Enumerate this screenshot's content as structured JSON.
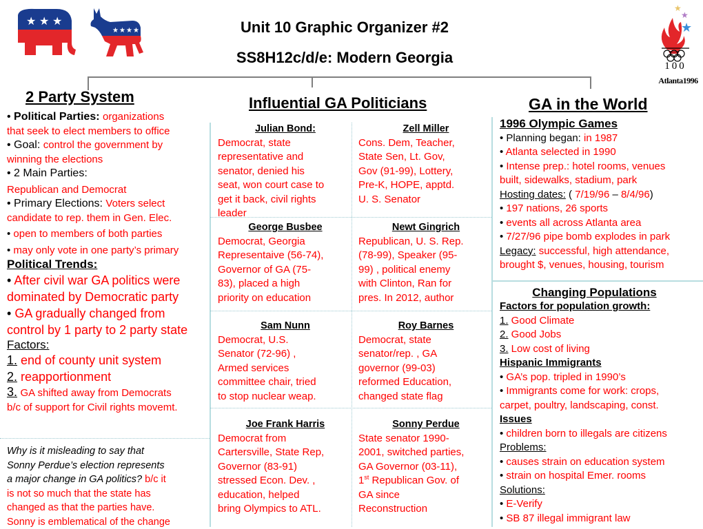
{
  "header": {
    "title": "Unit 10 Graphic Organizer #2",
    "subtitle": "SS8H12c/d/e:  Modern Georgia",
    "logos": {
      "republican": "elephant-icon",
      "democrat": "donkey-icon",
      "olympics": "atlanta-1996-olympic-logo",
      "olympics_text": "Atlanta1996",
      "olympics_number": "100"
    },
    "colors": {
      "answer_red": "#ff0000",
      "party_blue": "#1a3c8f",
      "party_red": "#e3262a",
      "divider": "#b7dde0",
      "connector": "#7f7f7f"
    }
  },
  "left": {
    "title": "2 Party System",
    "political_parties_label": "Political Parties:",
    "political_parties_text_1": "organizations",
    "political_parties_text_2": "that seek to elect members to office",
    "goal_label": "Goal:",
    "goal_text_1": "control the government by",
    "goal_text_2": "winning  the elections",
    "main_parties_label": "2 Main Parties:",
    "main_parties_text": "Republican and Democrat",
    "primary_label": "Primary Elections:",
    "primary_text_1": "Voters select",
    "primary_text_2": "candidate to rep. them in Gen. Elec.",
    "primary_bullet_1": "open to members of both parties",
    "primary_bullet_2": "may only vote in one party’s primary",
    "trends_label": "Political Trends:",
    "trend_1a": "After civil war GA politics were",
    "trend_1b": "dominated by Democratic party",
    "trend_2a": "GA gradually changed from",
    "trend_2b": "control by 1 party to 2 party state",
    "factors_label": "Factors:",
    "factors": [
      {
        "num": "1.",
        "text": "end of county unit system"
      },
      {
        "num": "2.",
        "text": "reapportionment"
      },
      {
        "num": "3.",
        "text": "GA shifted away from Democrats",
        "text2": "b/c of support for Civil rights movemt."
      }
    ],
    "question": {
      "q1": "Why is it misleading  to say that",
      "q2": "Sonny Perdue’s election  represents",
      "q3": "a major change in GA politics?",
      "a1": "b/c  it",
      "a2": "is not so much that the state has",
      "a3": "changed as that the parties have.",
      "a4": "Sonny is emblematical of the change"
    }
  },
  "middle": {
    "title": "Influential GA Politicians",
    "politicians": [
      {
        "name": "Julian Bond:",
        "desc": " Democrat, state\nrepresentative and\nsenator, denied his\nseat, won court case to\nget it back, civil rights\nleader"
      },
      {
        "name": "Zell Miller",
        "desc": "Cons. Dem, Teacher,\nState Sen, Lt. Gov,\nGov (91-99), Lottery,\nPre-K, HOPE, apptd.\nU. S. Senator"
      },
      {
        "name": "George Busbee",
        "desc": "Democrat, Georgia\nRepresentaive (56-74),\nGovernor of GA  (75-\n83), placed a high\npriority on education"
      },
      {
        "name": "Newt Gingrich",
        "desc": "Republican, U. S. Rep.\n(78-99), Speaker (95-\n99) , political enemy\nwith Clinton, Ran for\npres. In 2012, author"
      },
      {
        "name": "Sam Nunn",
        "desc": "Democrat, U.S.\nSenator (72-96) ,\nArmed services\ncommittee chair, tried\nto stop nuclear weap."
      },
      {
        "name": "Roy Barnes",
        "desc": "Democrat, state\nsenator/rep. , GA\ngovernor (99-03)\nreformed Education,\nchanged state flag"
      },
      {
        "name": "Joe Frank Harris",
        "desc": "Democrat from\nCartersville, State Rep,\nGovernor (83-91)\nstressed Econ. Dev. ,\neducation, helped\nbring Olympics to ATL."
      },
      {
        "name": "Sonny Perdue",
        "desc_1": "State senator 1990-\n2001, switched parties,\nGA Governor (03-11),\n",
        "desc_sup_num": "1",
        "desc_sup": "st",
        "desc_2": " Republican Gov. of\nGA since\nReconstruction"
      }
    ]
  },
  "right": {
    "title": "GA in the World",
    "olympics_header": "1996 Olympic Games",
    "planning_label": "Planning began:",
    "planning_text": " in 1987",
    "selected": "Atlanta selected in 1990",
    "prep_1": "Intense prep.: hotel rooms, venues",
    "prep_2": "built, sidewalks, stadium, park",
    "hosting_label": "Hosting  dates:",
    "hosting_open": " ( ",
    "hosting_start": "7/19/96",
    "hosting_dash": " – ",
    "hosting_end": "8/4/96",
    "hosting_close": ")",
    "nations": "197 nations, 26 sports",
    "events": "events all across Atlanta area",
    "bomb": "7/27/96 pipe bomb explodes in park",
    "legacy_label": "Legacy:",
    "legacy_1": " successful, high attendance,",
    "legacy_2": "brought $, venues, housing, tourism",
    "pop_title": "Changing Populations",
    "growth_label": "Factors for population growth:",
    "growth": [
      {
        "num": "1.",
        "text": " Good Climate"
      },
      {
        "num": "2.",
        "text": " Good Jobs"
      },
      {
        "num": "3.",
        "text": " Low cost of living"
      }
    ],
    "hispanic_label": "Hispanic Immigrants",
    "hispanic_1": "GA’s pop. tripled in 1990’s",
    "hispanic_2a": "Immigrants come for work: crops,",
    "hispanic_2b": "carpet, poultry, landscaping, const.",
    "issues_label": "Issues",
    "issues_1": "children born to illegals are citizens",
    "problems_label": "Problems:",
    "problems": [
      "causes strain on education  system",
      "strain on hospital Emer. rooms"
    ],
    "solutions_label": "Solutions:",
    "solutions": [
      "E-Verify",
      "SB 87 illegal immigrant law"
    ]
  }
}
